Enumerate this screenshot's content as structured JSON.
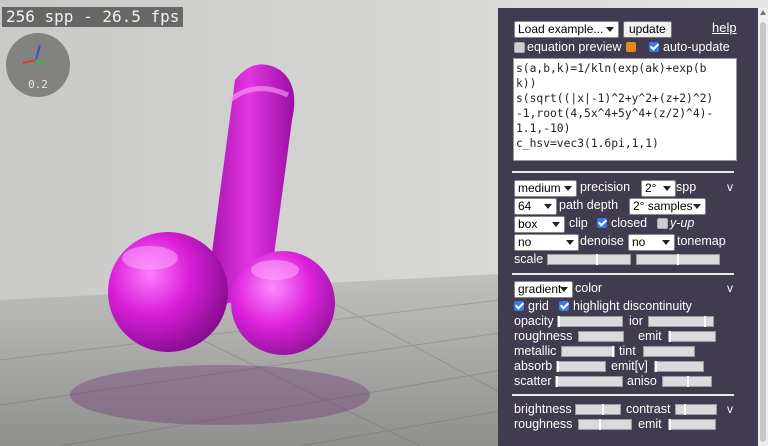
{
  "viewport": {
    "stats": "256 spp - 26.5 fps",
    "axes_value": "0.2",
    "colors": {
      "shape": "#d820d8",
      "floor": "#bdbdbd"
    }
  },
  "panel": {
    "load_example": "Load example...",
    "update": "update",
    "help": "help",
    "equation_preview": "equation preview",
    "auto_update": "auto-update",
    "equation_lines": [
      "s(a,b,k)=1/kln(exp(ak)+exp(b",
      "k))",
      "s(sqrt((|x|-1)^2+y^2+(z+2)^2)",
      "-1,root(4,5x^4+5y^4+(z/2)^4)-",
      "1.1,-10)",
      "c_hsv=vec3(1.6pi,1,1)"
    ],
    "render": {
      "precision_value": "medium",
      "precision_label": "precision",
      "spp_value": "2°",
      "spp_label": "spp",
      "path_depth_value": "64",
      "path_depth_label": "path depth",
      "samples_value": "2° samples",
      "clip_value": "box",
      "clip_label": "clip",
      "closed_label": "closed",
      "yup_label": "y-up",
      "denoise_value": "no",
      "denoise_label": "denoise",
      "tonemap_value": "no",
      "tonemap_label": "tonemap",
      "scale_label": "scale",
      "collapse": "v"
    },
    "material": {
      "color_mode": "gradient",
      "color_label": "color",
      "grid_label": "grid",
      "highlight_label": "highlight discontinuity",
      "opacity": "opacity",
      "ior": "ior",
      "roughness": "roughness",
      "emit": "emit",
      "metallic": "metallic",
      "tint": "tint",
      "absorb": "absorb",
      "emit_v": "emit[v]",
      "scatter": "scatter",
      "aniso": "aniso",
      "collapse": "v"
    },
    "lighting": {
      "brightness": "brightness",
      "contrast": "contrast",
      "roughness": "roughness",
      "emit": "emit",
      "collapse": "v"
    }
  }
}
